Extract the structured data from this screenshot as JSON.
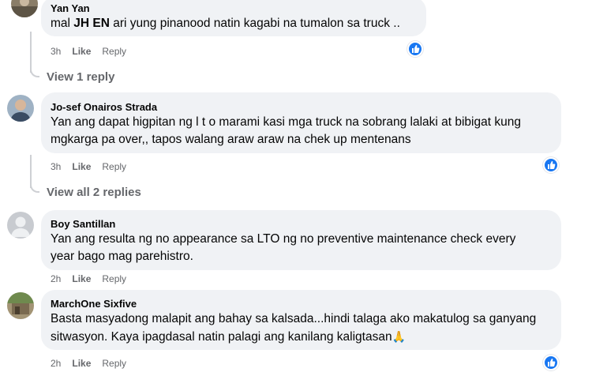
{
  "comments": [
    {
      "author": "Yan Yan",
      "text_bold": "JH EN",
      "text_before": "mal ",
      "text_after": " ari yung pinanood natin kagabi na tumalon sa truck ..",
      "time": "3h",
      "like": "Like",
      "reply": "Reply"
    },
    {
      "author": "Jo-sef Onairos Strada",
      "line1": "Yan ang dapat higpitan ng l t o marami kasi mga truck na sobrang lalaki at bibigat kung",
      "line2": "mgkarga pa over,, tapos walang araw araw na chek up mentenans",
      "time": "3h",
      "like": "Like",
      "reply": "Reply"
    },
    {
      "author": "Boy Santillan",
      "line1": "Yan ang resulta ng no appearance sa LTO ng no preventive maintenance check every",
      "line2": "year bago mag parehistro.",
      "time": "2h",
      "like": "Like",
      "reply": "Reply"
    },
    {
      "author": "MarchOne Sixfive",
      "line1": "Basta masyadong malapit ang bahay sa kalsada...hindi talaga ako makatulog sa ganyang",
      "line2": "sitwasyon. Kaya ipagdasal natin palagi ang kanilang kaligtasan",
      "emoji": "🙏",
      "time": "2h",
      "like": "Like",
      "reply": "Reply"
    }
  ],
  "view_replies": {
    "first": "View 1 reply",
    "second": "View all 2 replies"
  },
  "colors": {
    "bubble": "#f0f2f5",
    "meta": "#65676b",
    "like_blue": "#1877f2",
    "thread_line": "#ced0d4"
  },
  "icons": {
    "reaction": "thumbs-up-icon"
  }
}
